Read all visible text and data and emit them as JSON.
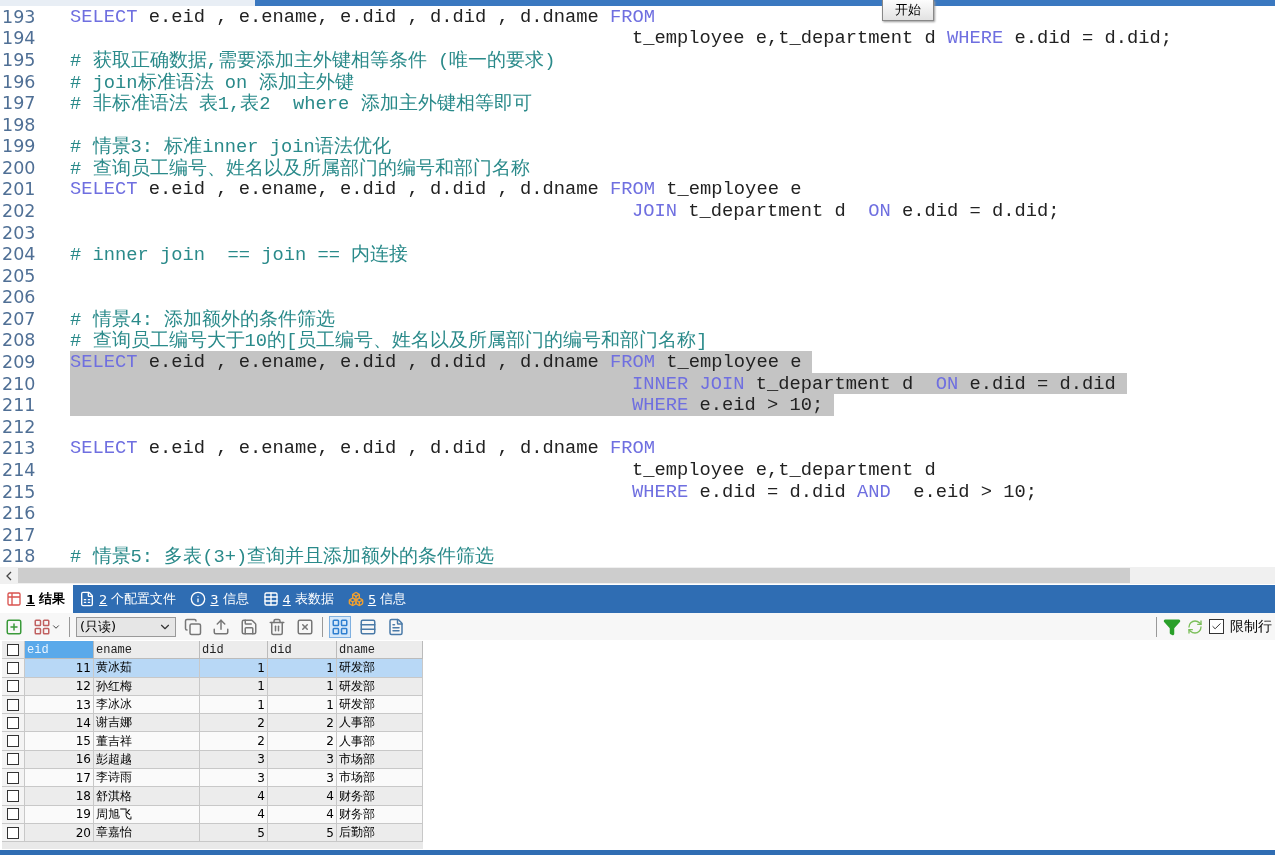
{
  "start_button": "开始",
  "editor": {
    "lines": [
      {
        "number": "193",
        "selected": false,
        "continuation": false,
        "tokens": [
          {
            "kind": "keyword",
            "text": "SELECT"
          },
          {
            "kind": "code",
            "text": " e.eid , e.ename, e.did , d.did , d.dname "
          },
          {
            "kind": "keyword",
            "text": "FROM"
          }
        ]
      },
      {
        "number": "194",
        "selected": false,
        "continuation": true,
        "tokens": [
          {
            "kind": "code",
            "text": "t_employee e,t_department d "
          },
          {
            "kind": "keyword",
            "text": "WHERE"
          },
          {
            "kind": "code",
            "text": " e.did = d.did;"
          }
        ]
      },
      {
        "number": "195",
        "selected": false,
        "continuation": false,
        "tokens": [
          {
            "kind": "comment",
            "text": "# 获取正确数据,需要添加主外键相等条件 (唯一的要求)"
          }
        ]
      },
      {
        "number": "196",
        "selected": false,
        "continuation": false,
        "tokens": [
          {
            "kind": "comment",
            "text": "# join标准语法 on 添加主外键"
          }
        ]
      },
      {
        "number": "197",
        "selected": false,
        "continuation": false,
        "tokens": [
          {
            "kind": "comment",
            "text": "# 非标准语法 表1,表2  where 添加主外键相等即可"
          }
        ]
      },
      {
        "number": "198"
      },
      {
        "number": "199",
        "selected": false,
        "continuation": false,
        "tokens": [
          {
            "kind": "comment",
            "text": "# 情景3: 标准inner join语法优化"
          }
        ]
      },
      {
        "number": "200",
        "selected": false,
        "continuation": false,
        "tokens": [
          {
            "kind": "comment",
            "text": "# 查询员工编号、姓名以及所属部门的编号和部门名称"
          }
        ]
      },
      {
        "number": "201",
        "selected": false,
        "continuation": false,
        "tokens": [
          {
            "kind": "keyword",
            "text": "SELECT"
          },
          {
            "kind": "code",
            "text": " e.eid , e.ename, e.did , d.did , d.dname "
          },
          {
            "kind": "keyword",
            "text": "FROM"
          },
          {
            "kind": "code",
            "text": " t_employee e"
          }
        ]
      },
      {
        "number": "202",
        "selected": false,
        "continuation": true,
        "tokens": [
          {
            "kind": "keyword",
            "text": "JOIN"
          },
          {
            "kind": "code",
            "text": " t_department d  "
          },
          {
            "kind": "keyword",
            "text": "ON"
          },
          {
            "kind": "code",
            "text": " e.did = d.did;"
          }
        ]
      },
      {
        "number": "203"
      },
      {
        "number": "204",
        "selected": false,
        "continuation": false,
        "tokens": [
          {
            "kind": "comment",
            "text": "# inner join  == join == 内连接"
          }
        ]
      },
      {
        "number": "205"
      },
      {
        "number": "206"
      },
      {
        "number": "207",
        "selected": false,
        "continuation": false,
        "tokens": [
          {
            "kind": "comment",
            "text": "# 情景4: 添加额外的条件筛选"
          }
        ]
      },
      {
        "number": "208",
        "selected": false,
        "continuation": false,
        "tokens": [
          {
            "kind": "comment",
            "text": "# 查询员工编号大于10的[员工编号、姓名以及所属部门的编号和部门名称]"
          }
        ]
      },
      {
        "number": "209",
        "selected": true,
        "continuation": false,
        "tokens": [
          {
            "kind": "keyword",
            "text": "SELECT"
          },
          {
            "kind": "code",
            "text": " e.eid , e.ename, e.did , d.did , d.dname "
          },
          {
            "kind": "keyword",
            "text": "FROM"
          },
          {
            "kind": "code",
            "text": " t_employee e"
          }
        ]
      },
      {
        "number": "210",
        "selected": true,
        "continuation": true,
        "tokens": [
          {
            "kind": "keyword",
            "text": "INNER JOIN"
          },
          {
            "kind": "code",
            "text": " t_department d  "
          },
          {
            "kind": "keyword",
            "text": "ON"
          },
          {
            "kind": "code",
            "text": " e.did = d.did"
          }
        ]
      },
      {
        "number": "211",
        "selected": true,
        "continuation": true,
        "tokens": [
          {
            "kind": "keyword",
            "text": "WHERE"
          },
          {
            "kind": "code",
            "text": " e.eid > 10;"
          }
        ]
      },
      {
        "number": "212"
      },
      {
        "number": "213",
        "selected": false,
        "continuation": false,
        "tokens": [
          {
            "kind": "keyword",
            "text": "SELECT"
          },
          {
            "kind": "code",
            "text": " e.eid , e.ename, e.did , d.did , d.dname "
          },
          {
            "kind": "keyword",
            "text": "FROM"
          }
        ]
      },
      {
        "number": "214",
        "selected": false,
        "continuation": true,
        "tokens": [
          {
            "kind": "code",
            "text": "t_employee e,t_department d"
          }
        ]
      },
      {
        "number": "215",
        "selected": false,
        "continuation": true,
        "tokens": [
          {
            "kind": "keyword",
            "text": "WHERE"
          },
          {
            "kind": "code",
            "text": " e.did = d.did "
          },
          {
            "kind": "keyword",
            "text": "AND"
          },
          {
            "kind": "code",
            "text": "  e.eid > 10;"
          }
        ]
      },
      {
        "number": "216"
      },
      {
        "number": "217"
      },
      {
        "number": "218",
        "selected": false,
        "continuation": false,
        "tokens": [
          {
            "kind": "comment",
            "text": "# 情景5: 多表(3+)查询并且添加额外的条件筛选"
          }
        ]
      }
    ]
  },
  "result_tabs": [
    {
      "kind": "result",
      "key": "1",
      "label": "结果",
      "selected": true
    },
    {
      "kind": "profile",
      "key": "2",
      "label": "个配置文件",
      "selected": false
    },
    {
      "kind": "info",
      "key": "3",
      "label": "信息",
      "selected": false
    },
    {
      "kind": "table",
      "key": "4",
      "label": "表数据",
      "selected": false
    },
    {
      "kind": "blocks",
      "key": "5",
      "label": "信息",
      "selected": false
    }
  ],
  "toolbar": {
    "mode": "(只读)",
    "views": [
      {
        "selected": true
      },
      {
        "selected": false
      },
      {
        "selected": false
      }
    ],
    "limit_rows": {
      "label": "限制行",
      "checked": true
    }
  },
  "grid": {
    "select_all": {
      "checked": false
    },
    "columns": [
      "eid",
      "ename",
      "did",
      "did",
      "dname"
    ],
    "rows": [
      {
        "checked": false,
        "selected": true,
        "cells": [
          "11",
          "黄冰茹",
          "1",
          "1",
          "研发部"
        ]
      },
      {
        "checked": false,
        "selected": false,
        "cells": [
          "12",
          "孙红梅",
          "1",
          "1",
          "研发部"
        ]
      },
      {
        "checked": false,
        "selected": false,
        "cells": [
          "13",
          "李冰冰",
          "1",
          "1",
          "研发部"
        ]
      },
      {
        "checked": false,
        "selected": false,
        "cells": [
          "14",
          "谢吉娜",
          "2",
          "2",
          "人事部"
        ]
      },
      {
        "checked": false,
        "selected": false,
        "cells": [
          "15",
          "董吉祥",
          "2",
          "2",
          "人事部"
        ]
      },
      {
        "checked": false,
        "selected": false,
        "cells": [
          "16",
          "彭超越",
          "3",
          "3",
          "市场部"
        ]
      },
      {
        "checked": false,
        "selected": false,
        "cells": [
          "17",
          "李诗雨",
          "3",
          "3",
          "市场部"
        ]
      },
      {
        "checked": false,
        "selected": false,
        "cells": [
          "18",
          "舒淇格",
          "4",
          "4",
          "财务部"
        ]
      },
      {
        "checked": false,
        "selected": false,
        "cells": [
          "19",
          "周旭飞",
          "4",
          "4",
          "财务部"
        ]
      },
      {
        "checked": false,
        "selected": false,
        "cells": [
          "20",
          "章嘉怡",
          "5",
          "5",
          "后勤部"
        ]
      }
    ]
  }
}
